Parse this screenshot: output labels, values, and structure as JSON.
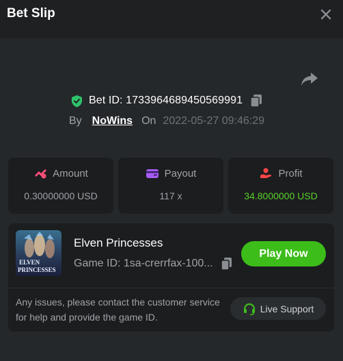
{
  "header": {
    "title": "Bet Slip"
  },
  "bet": {
    "id_text": "Bet ID: 1733964689450569991",
    "by_label": "By",
    "username": "NoWins",
    "on_label": "On",
    "datetime": "2022-05-27 09:46:29"
  },
  "stats": [
    {
      "label": "Amount",
      "value": "0.30000000 USD",
      "icon": "amount-icon"
    },
    {
      "label": "Payout",
      "value": "117 x",
      "icon": "wallet-icon"
    },
    {
      "label": "Profit",
      "value": "34.8000000 USD",
      "icon": "profit-icon"
    }
  ],
  "game": {
    "name": "Elven Princesses",
    "id_text": "Game ID: 1sa-crerrfax-100...",
    "thumb_text_top": "ELVEN",
    "thumb_text_bottom": "PRINCESSES",
    "play_label": "Play Now",
    "issue_text": "Any issues, please contact the customer service for help and provide the game ID.",
    "support_label": "Live Support"
  },
  "colors": {
    "accent_green": "#3dbd1a",
    "profit_green": "#5bd12a",
    "shield_green": "#2fc36b",
    "panel": "#25282b",
    "card": "#1b1d1f"
  }
}
